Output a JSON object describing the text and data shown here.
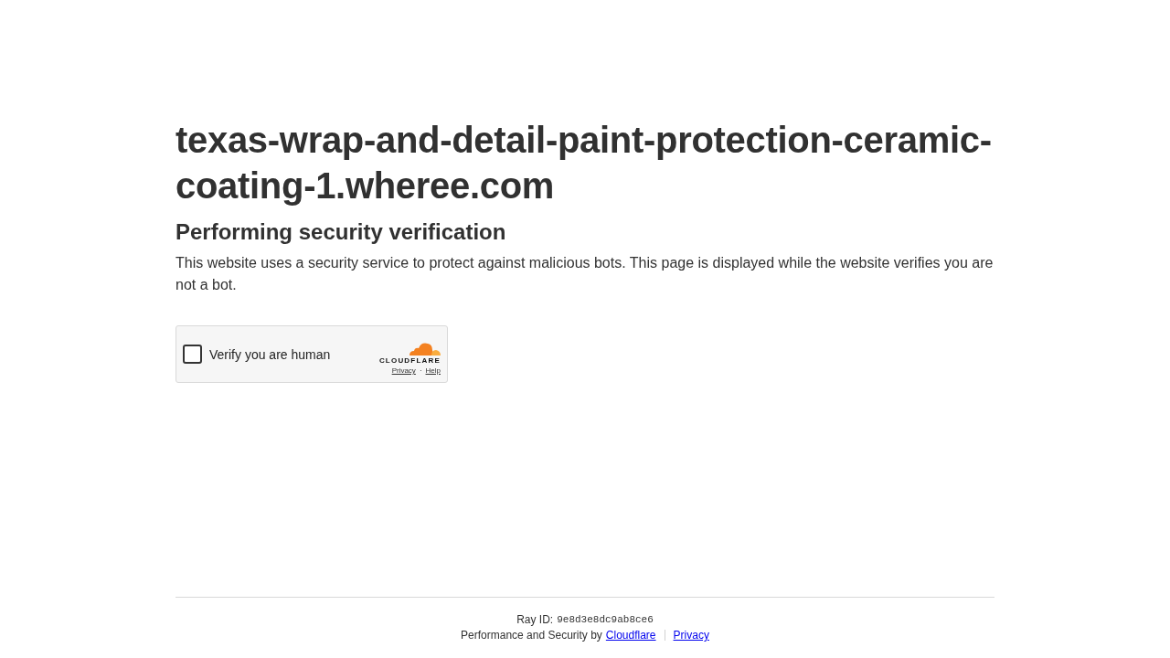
{
  "heading": "texas-wrap-and-detail-paint-protection-ceramic-coating-1.wheree.com",
  "subheading": "Performing security verification",
  "description": "This website uses a security service to protect against malicious bots. This page is displayed while the website verifies you are not a bot.",
  "widget": {
    "checkbox": {
      "label": "Verify you are human",
      "checked": false
    },
    "logo_text": "CLOUDFLARE",
    "links": [
      "Privacy",
      "Help"
    ],
    "separator": "·"
  },
  "footer": {
    "ray_label": "Ray ID:",
    "ray_id": "9e8d3e8dc9ab8ce6",
    "credit": "Performance and Security by",
    "links": [
      "Cloudflare",
      "Privacy"
    ]
  }
}
